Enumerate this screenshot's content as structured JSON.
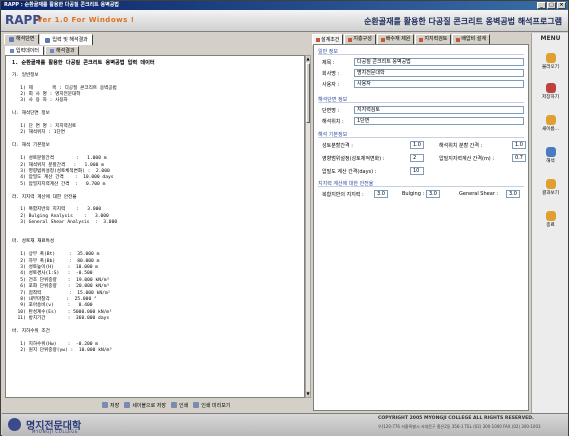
{
  "window": {
    "title": "RAPP : 순환골재를 활용한 다공질 콘크리트 옹벽공법",
    "controls": [
      "_",
      "□",
      "×"
    ]
  },
  "banner": {
    "logo": "RAPP",
    "version": "Ver 1.0 For Windows !",
    "title": "순환골재를 활용한 다공질 콘크리트 옹벽공법 해석프로그램"
  },
  "left_tabs": [
    "해석단면",
    "입력 및 해석결과"
  ],
  "left_subtabs": [
    "입력데이터",
    "해석결과"
  ],
  "document_lines": [
    "1. 순환골재를 활용한 다공질 콘크리트 옹벽공법 입력 데이터",
    "",
    "가. 일반정보",
    "",
    "   1) 제       목 : 다공질 콘크리트 옹벽공법",
    "   2) 회 사 명 : 명지전문대학",
    "   3) 사 용 자 : 사용자",
    "",
    "나. 해석단면 정보",
    "",
    "   1) 단 면 명 : 지지력검토",
    "   2) 해석위치 : 1단면",
    "",
    "다. 해석 기본정보",
    "",
    "   1) 성토분할간격        :   1.000 m",
    "   2) 해석위치 분할간격   :   1.000 m",
    "   3) 영향범위설정(성토체적변화) :  2.000",
    "   4) 압밀도 계산 간격    :  10.000 days",
    "   5) 압밀지지력계산 간격  :   0.700 m",
    "",
    "라. 지지력 계산에 대한 안전율",
    "",
    "   1) 복합지반의 지지력    :   3.000",
    "   2) Bulging Analysis    :   3.000",
    "   3) General Shear Analysis  :  3.000",
    "",
    "",
    "마. 성토재 재료특성",
    "",
    "   1) 상부 폭(Bt)     :  35.000 m",
    "   2) 하부 폭(Bb)     :  80.000 m",
    "   3) 성토높이(H)     :  10.000 m",
    "   4) 성토경사(1:S)   :  -0.500",
    "   5) 건조 단위중량    :  19.000 kN/m³",
    "   6) 포화 단위중량    :  20.000 kN/m³",
    "   7) 점착력          :  15.000 kN/m²",
    "   8) 내부마찰각      :  25.000 °",
    "   9) 포아송비(ν)     :   0.400",
    "  10) 탄성계수(Es)    : 5000.000 kN/m²",
    "  11) 방치기간        :  360.000 days",
    "",
    "바. 지하수위 조건",
    "",
    "   1) 지하수위(Hw)    :  -0.200 m",
    "   2) 원지 단위중량(γw) :  10.000 kN/m³"
  ],
  "bottom_buttons": [
    "저장",
    "세이블으로 저장",
    "인쇄",
    "인쇄 미리보기"
  ],
  "right_tabs": [
    "설계조건",
    "지층구성",
    "배수재 제원",
    "지지력검토",
    "배압비 설계"
  ],
  "form": {
    "general_section": "일반 정보",
    "title_label": "제목 :",
    "title_value": "다공질 콘크리트 옹벽공법",
    "company_label": "회사명 :",
    "company_value": "명지전문대학",
    "user_label": "사용자 :",
    "user_value": "사용자",
    "section_section": "해석단면 정보",
    "section_name_label": "단면명 :",
    "section_name_value": "지지력검토",
    "position_label": "해석위치 :",
    "position_value": "1단면",
    "basic_section": "해석 기본정보",
    "fill_split_label": "성토분할간격 :",
    "fill_split_value": "1.0",
    "pos_split_label": "해석위치 분할 간격 :",
    "pos_split_value": "1.0",
    "influence_label": "영향범위설정(성토체적변화) :",
    "influence_value": "2",
    "bearing_interval_label": "압밀지지력계산 간격(m) :",
    "bearing_interval_value": "0.7",
    "consolidation_label": "압밀도 계산 간격(days) :",
    "consolidation_value": "10",
    "safety_section": "지지력 계산에 대한 안전율",
    "composite_label": "복합지반의 지지력 :",
    "composite_value": "3.0",
    "bulging_label": "Bulging :",
    "bulging_value": "3.0",
    "shear_label": "General Shear :",
    "shear_value": "3.0"
  },
  "menu": {
    "title": "MENU",
    "items": [
      {
        "label": "불러오기",
        "icon": "folder-open-icon",
        "color": "#e0a030"
      },
      {
        "label": "저장하기",
        "icon": "save-icon",
        "color": "#c04040"
      },
      {
        "label": "새이름...",
        "icon": "save-as-icon",
        "color": "#e0a030"
      },
      {
        "label": "해석",
        "icon": "analyze-icon",
        "color": "#4a7ac0"
      },
      {
        "label": "결과보기",
        "icon": "view-result-icon",
        "color": "#e0a030"
      },
      {
        "label": "종료",
        "icon": "exit-icon",
        "color": "#e0a030"
      }
    ]
  },
  "footer": {
    "logo": "명지전문대학",
    "logo_sub": "MYONGJI COLLEGE",
    "copyright": "COPYRIGHT 2005 MYONGJI COLLEGE ALL RIGHTS RESERVED.",
    "address": "우)120-776 서울특별시 서대문구 홍은2동 356-1 TEL (02) 300-1000 FAX (02) 300-1003"
  }
}
